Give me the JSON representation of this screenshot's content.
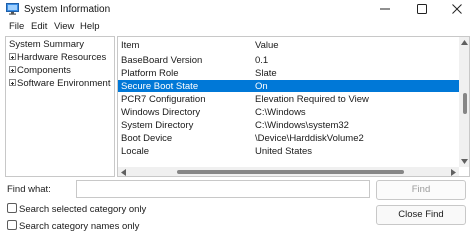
{
  "window": {
    "title": "System Information"
  },
  "menu": [
    "File",
    "Edit",
    "View",
    "Help"
  ],
  "tree": {
    "root": "System Summary",
    "children": [
      "Hardware Resources",
      "Components",
      "Software Environment"
    ]
  },
  "table": {
    "headers": {
      "item": "Item",
      "value": "Value"
    },
    "rows": [
      {
        "item": "BaseBoard Version",
        "value": "0.1"
      },
      {
        "item": "Platform Role",
        "value": "Slate"
      },
      {
        "item": "Secure Boot State",
        "value": "On"
      },
      {
        "item": "PCR7 Configuration",
        "value": "Elevation Required to View"
      },
      {
        "item": "Windows Directory",
        "value": "C:\\Windows"
      },
      {
        "item": "System Directory",
        "value": "C:\\Windows\\system32"
      },
      {
        "item": "Boot Device",
        "value": "\\Device\\HarddiskVolume2"
      },
      {
        "item": "Locale",
        "value": "United States"
      }
    ],
    "selected_row": "Secure Boot State"
  },
  "find": {
    "label": "Find what:",
    "value": "",
    "find_button": "Find",
    "close_button": "Close Find",
    "option_selected": "Search selected category only",
    "option_names": "Search category names only"
  },
  "colors": {
    "selection": "#0078d7"
  }
}
